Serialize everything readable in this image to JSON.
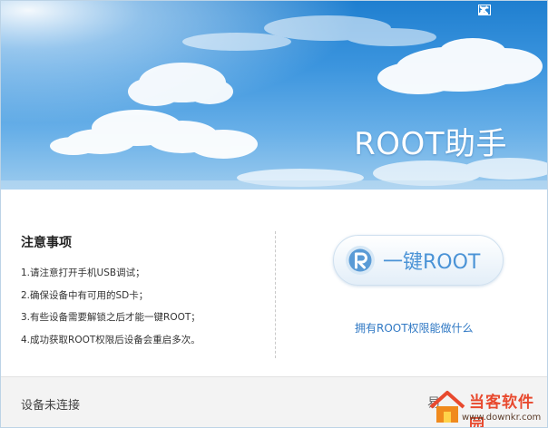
{
  "banner": {
    "title": "ROOT助手"
  },
  "window_controls": [
    {
      "name": "skin-button",
      "icon": "skin-icon"
    },
    {
      "name": "minimize-button",
      "icon": "minimize-icon"
    },
    {
      "name": "close-button",
      "icon": "close-icon"
    }
  ],
  "notice": {
    "title": "注意事项",
    "items": [
      "1.请注意打开手机USB调试；",
      "2.确保设备中有可用的SD卡；",
      "3.有些设备需要解锁之后才能一键ROOT；",
      "4.成功获取ROOT权限后设备会重启多次。"
    ]
  },
  "root_button": {
    "label": "一键ROOT",
    "icon": "root-logo-icon"
  },
  "root_link": "拥有ROOT权限能做什么",
  "status": {
    "connection": "设备未连接",
    "right_text": "易"
  },
  "watermark": {
    "name": "当客软件园",
    "url": "www.downkr.com"
  },
  "colors": {
    "banner_blue": "#3c95de",
    "button_text": "#4a93d6",
    "link": "#2f78c4",
    "watermark": "#e8492e"
  }
}
